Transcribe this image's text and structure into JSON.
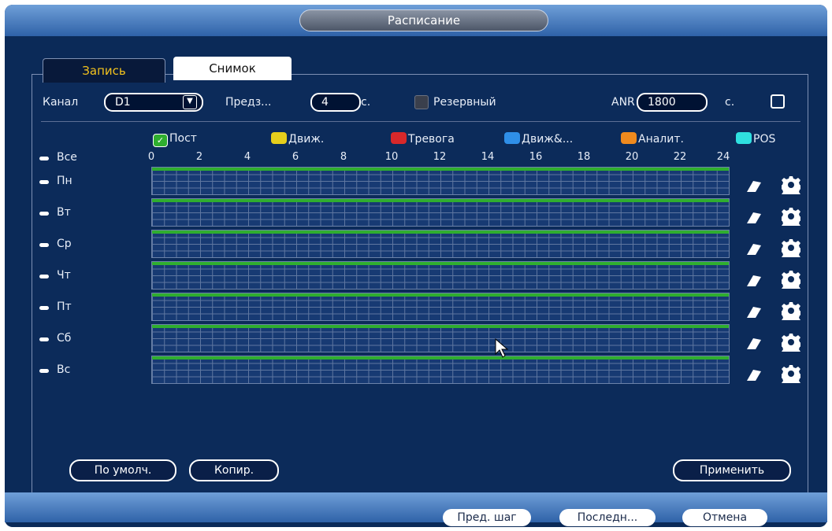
{
  "window": {
    "title": "Расписание"
  },
  "tabs": [
    {
      "label": "Запись",
      "active": true
    },
    {
      "label": "Снимок",
      "active": false
    }
  ],
  "settings": {
    "channel_label": "Канал",
    "channel_value": "D1",
    "pre_label": "Предз...",
    "pre_value": "4",
    "pre_unit": "с.",
    "backup_label": "Резервный",
    "anr_label": "ANR",
    "anr_value": "1800",
    "anr_unit": "с."
  },
  "legend": [
    {
      "label": "Пост",
      "color": "#2fae2f",
      "checked": true
    },
    {
      "label": "Движ.",
      "color": "#e6cf1c"
    },
    {
      "label": "Тревога",
      "color": "#d8282a"
    },
    {
      "label": "Движ&...",
      "color": "#2f8fe8"
    },
    {
      "label": "Аналит.",
      "color": "#ef8a1e"
    },
    {
      "label": "POS",
      "color": "#2fe0e0"
    }
  ],
  "all_label": "Все",
  "hours": [
    "0",
    "2",
    "4",
    "6",
    "8",
    "10",
    "12",
    "14",
    "16",
    "18",
    "20",
    "22",
    "24"
  ],
  "days": [
    "Пн",
    "Вт",
    "Ср",
    "Чт",
    "Пт",
    "Сб",
    "Вс"
  ],
  "actions": {
    "default_label": "По умолч.",
    "copy_label": "Копир.",
    "apply_label": "Применить"
  },
  "footer": {
    "prev_label": "Пред. шаг",
    "last_label": "Последн...",
    "cancel_label": "Отмена"
  },
  "icons": [
    "dropdown-arrow-icon",
    "eraser-icon",
    "gear-icon",
    "mouse-cursor-icon",
    "checkbox-icon"
  ]
}
